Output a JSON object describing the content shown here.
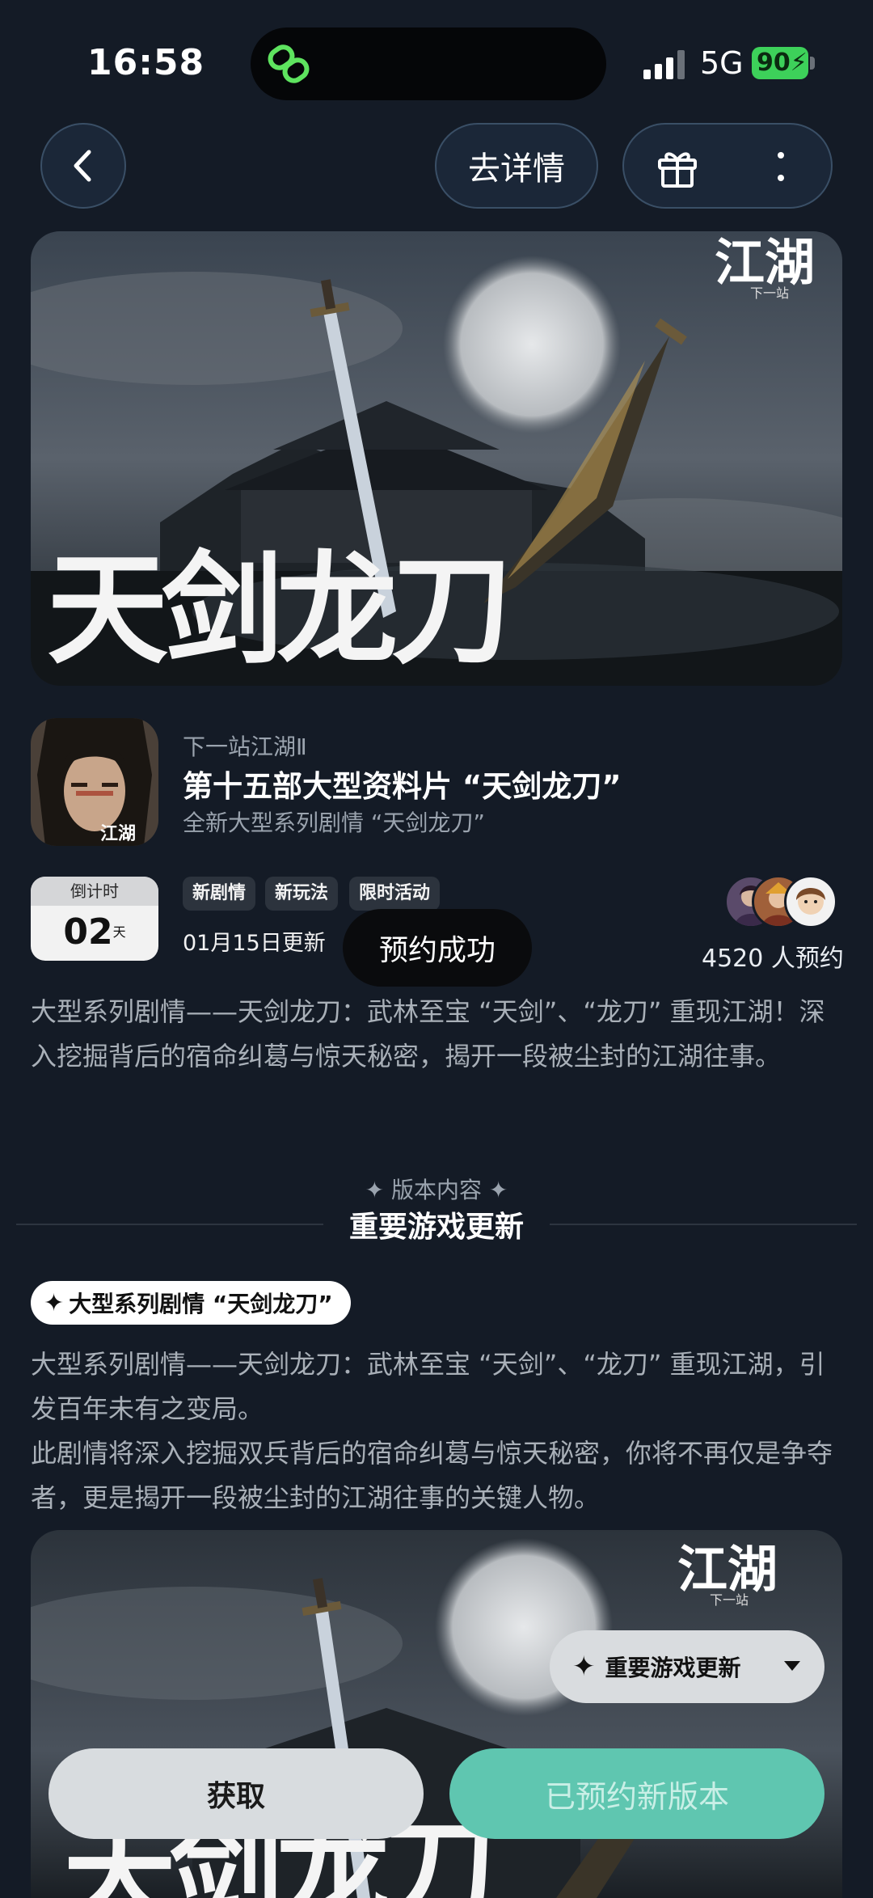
{
  "status_bar": {
    "time": "16:58",
    "network": "5G",
    "battery": "90"
  },
  "nav": {
    "details_label": "去详情"
  },
  "hero": {
    "logo_text": "江湖",
    "logo_sub": "下一站",
    "art_title": "天剑龙刀"
  },
  "game": {
    "name": "下一站江湖Ⅱ",
    "headline": "第十五部大型资料片 “天剑龙刀”",
    "subhead": "全新大型系列剧情 “天剑龙刀”"
  },
  "countdown": {
    "label": "倒计时",
    "days": "02",
    "unit": "天"
  },
  "tags": [
    "新剧情",
    "新玩法",
    "限时活动"
  ],
  "update_date": "01月15日更新",
  "toast": "预约成功",
  "reservations": "4520 人预约",
  "description": "大型系列剧情——天剑龙刀：武林至宝 “天剑”、“龙刀” 重现江湖！深入挖掘背后的宿命纠葛与惊天秘密，揭开一段被尘封的江湖往事。",
  "version_section": {
    "label": "版本内容",
    "title": "重要游戏更新"
  },
  "feature": {
    "pill_label": "大型系列剧情 “天剑龙刀”",
    "para1": "大型系列剧情——天剑龙刀：武林至宝 “天剑”、“龙刀” 重现江湖，引发百年未有之变局。",
    "para2": "此剧情将深入挖掘双兵背后的宿命纠葛与惊天秘密，你将不再仅是争夺者，更是揭开一段被尘封的江湖往事的关键人物。"
  },
  "floating": {
    "section_selector": "重要游戏更新",
    "get_button": "获取",
    "reserved_button": "已预约新版本"
  },
  "colors": {
    "accent": "#5fc6b0",
    "background": "#141b26",
    "battery": "#3dd15a"
  }
}
